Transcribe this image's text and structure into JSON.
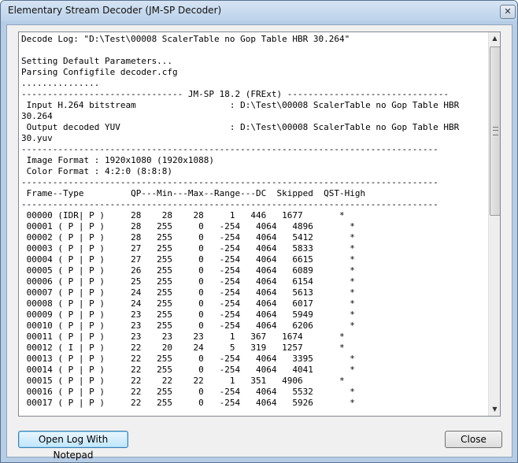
{
  "window": {
    "title": "Elementary Stream Decoder (JM-SP Decoder)",
    "close_glyph": "✕"
  },
  "log": {
    "lines": [
      "Decode Log: \"D:\\Test\\00008 ScalerTable no Gop Table HBR 30.264\"",
      "",
      "Setting Default Parameters...",
      "Parsing Configfile decoder.cfg",
      "...............",
      "------------------------------- JM-SP 18.2 (FRExt) -------------------------------",
      " Input H.264 bitstream                  : D:\\Test\\00008 ScalerTable no Gop Table HBR",
      "30.264",
      " Output decoded YUV                     : D:\\Test\\00008 ScalerTable no Gop Table HBR",
      "30.yuv",
      "--------------------------------------------------------------------------------",
      " Image Format : 1920x1080 (1920x1088)",
      " Color Format : 4:2:0 (8:8:8)",
      "--------------------------------------------------------------------------------",
      " Frame--Type         QP---Min---Max--Range---DC  Skipped  QST-High",
      "--------------------------------------------------------------------------------",
      " 00000 (IDR| P )     28    28    28     1   446   1677       *",
      " 00001 ( P | P )     28   255     0   -254   4064   4896       *",
      " 00002 ( P | P )     28   255     0   -254   4064   5412       *",
      " 00003 ( P | P )     27   255     0   -254   4064   5833       *",
      " 00004 ( P | P )     27   255     0   -254   4064   6615       *",
      " 00005 ( P | P )     26   255     0   -254   4064   6089       *",
      " 00006 ( P | P )     25   255     0   -254   4064   6154       *",
      " 00007 ( P | P )     24   255     0   -254   4064   5613       *",
      " 00008 ( P | P )     24   255     0   -254   4064   6017       *",
      " 00009 ( P | P )     23   255     0   -254   4064   5949       *",
      " 00010 ( P | P )     23   255     0   -254   4064   6206       *",
      " 00011 ( P | P )     23    23    23     1   367   1674       *",
      " 00012 ( I | P )     22    20    24     5   319   1257       *",
      " 00013 ( P | P )     22   255     0   -254   4064   3395       *",
      " 00014 ( P | P )     22   255     0   -254   4064   4041       *",
      " 00015 ( P | P )     22    22    22     1   351   4906       *",
      " 00016 ( P | P )     22   255     0   -254   4064   5532       *",
      " 00017 ( P | P )     22   255     0   -254   4064   5926       *"
    ]
  },
  "scrollbar": {
    "up_glyph": "▲",
    "down_glyph": "▼"
  },
  "buttons": {
    "open_log": "Open Log With Notepad",
    "close": "Close"
  }
}
